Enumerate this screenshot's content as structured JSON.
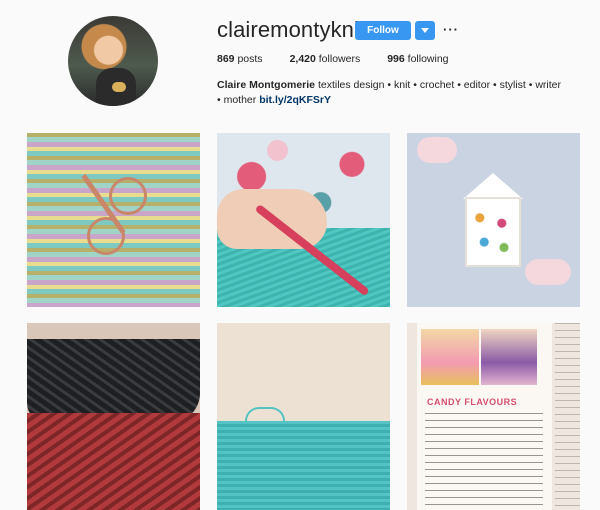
{
  "profile": {
    "username": "clairemontyknits",
    "follow_label": "Follow",
    "more_label": "···",
    "stats": [
      {
        "value": "869",
        "label": "posts"
      },
      {
        "value": "2,420",
        "label": "followers"
      },
      {
        "value": "996",
        "label": "following"
      }
    ],
    "bio": {
      "name": "Claire Montgomerie",
      "text": "textiles design • knit • crochet • editor • stylist • writer • mother",
      "link": "bit.ly/2qKFSrY"
    }
  },
  "posts": [
    {
      "id": "post-1"
    },
    {
      "id": "post-2"
    },
    {
      "id": "post-3"
    },
    {
      "id": "post-4"
    },
    {
      "id": "post-5"
    },
    {
      "id": "post-6",
      "heading": "CANDY FLAVOURS"
    }
  ],
  "colors": {
    "follow_button": "#3897f0",
    "link": "#003569",
    "text": "#262626",
    "background": "#fafafa"
  },
  "icons": {
    "dropdown": "chevron-down-icon",
    "more": "more-options-icon"
  }
}
